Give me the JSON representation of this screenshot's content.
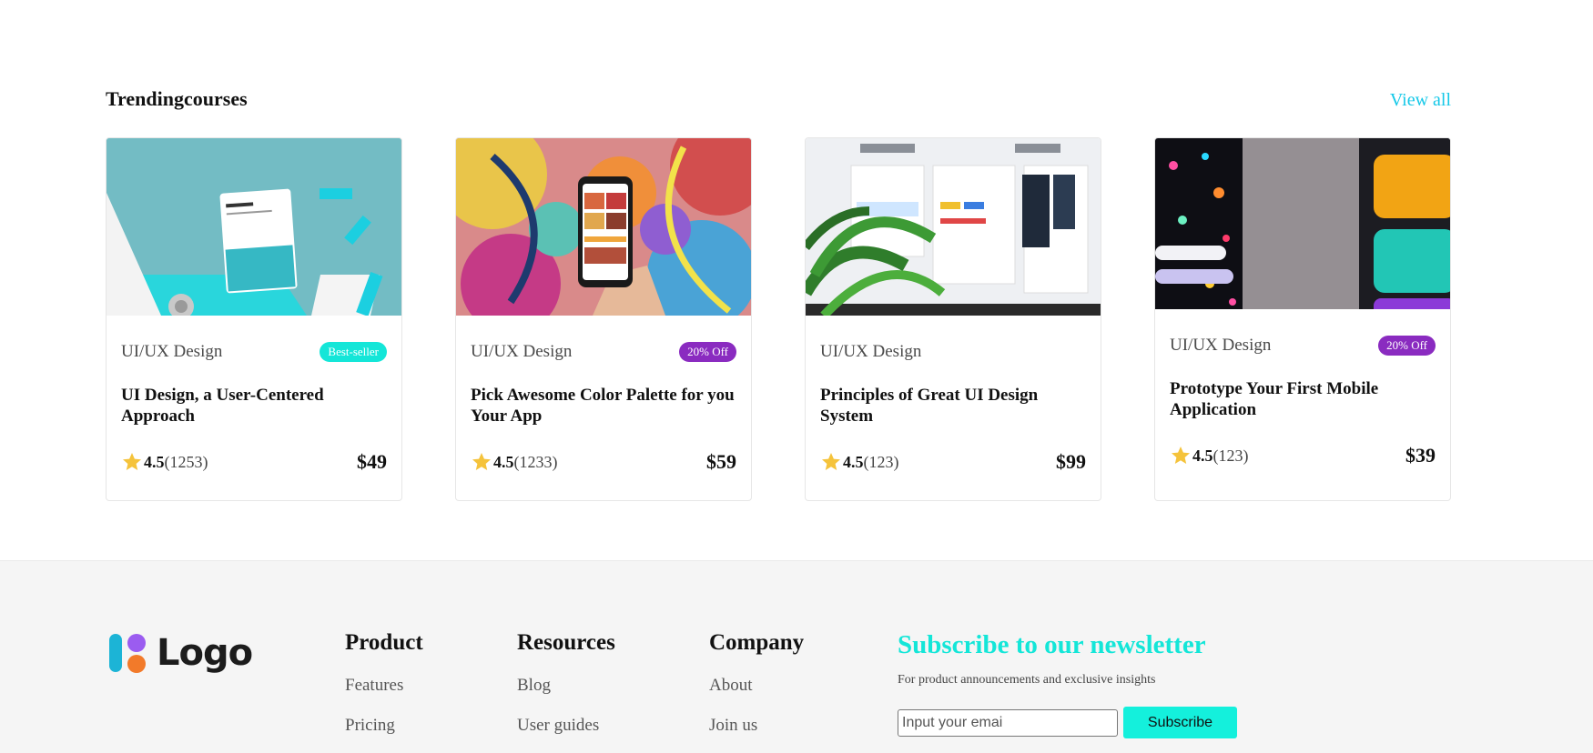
{
  "section": {
    "title": "Trendingcourses",
    "view_all": "View all"
  },
  "courses": [
    {
      "category": "UI/UX Design",
      "badge": "Best-seller",
      "badge_color": "#14e6d8",
      "title": "UI Design, a User-Centered Approach",
      "rating": "4.5",
      "reviews": "(1253)",
      "price": "$49"
    },
    {
      "category": "UI/UX Design",
      "badge": "20% Off",
      "badge_color": "#8a2bc0",
      "title": "Pick Awesome Color Palette for you Your App",
      "rating": "4.5",
      "reviews": "(1233)",
      "price": "$59"
    },
    {
      "category": "UI/UX Design",
      "badge": "",
      "badge_color": "",
      "title": "Principles of Great UI Design System",
      "rating": "4.5",
      "reviews": "(123)",
      "price": "$99"
    },
    {
      "category": "UI/UX Design",
      "badge": "20% Off",
      "badge_color": "#8a2bc0",
      "title": "Prototype Your First Mobile Application",
      "rating": "4.5",
      "reviews": "(123)",
      "price": "$39"
    }
  ],
  "footer": {
    "logo_text": "Logo",
    "columns": [
      {
        "title": "Product",
        "links": [
          "Features",
          "Pricing"
        ]
      },
      {
        "title": "Resources",
        "links": [
          "Blog",
          "User guides"
        ]
      },
      {
        "title": "Company",
        "links": [
          "About",
          "Join us"
        ]
      }
    ],
    "newsletter": {
      "title": "Subscribe to our newsletter",
      "subtitle": "For product announcements and exclusive insights",
      "placeholder": "Input your emai",
      "button": "Subscribe"
    }
  },
  "colors": {
    "accent": "#14c8e8",
    "teal": "#14e6d8",
    "purple": "#8a2bc0",
    "star": "#f5c33b"
  }
}
